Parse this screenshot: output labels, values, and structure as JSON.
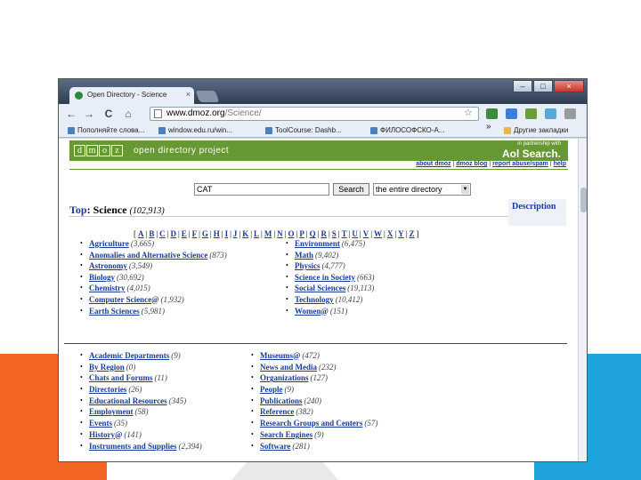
{
  "browser": {
    "tab_title": "Open Directory - Science",
    "tab_close": "×",
    "window_controls": {
      "minimize": "–",
      "maximize": "□",
      "close": "×"
    },
    "nav": {
      "back": "←",
      "forward": "→",
      "reload": "C",
      "home": "⌂"
    },
    "url_host": "www.dmoz.org",
    "url_path": "/Science/",
    "bookmarks": [
      {
        "label": "Пополняйте слова...",
        "icon": "page-icon"
      },
      {
        "label": "window.edu.ru/win...",
        "icon": "page-icon"
      },
      {
        "label": "ToolCourse: Dashb...",
        "icon": "page-icon"
      },
      {
        "label": "ФИЛОСОФСКО-А...",
        "icon": "page-icon"
      },
      {
        "label": "Другие закладки",
        "icon": "folder-icon"
      }
    ],
    "chevron": "»"
  },
  "dmoz": {
    "letters": [
      "d",
      "m",
      "o",
      "z"
    ],
    "tagline": "open directory project",
    "aol_small": "in partnership with",
    "aol": "Aol Search.",
    "toplinks": [
      "about dmoz",
      "dmoz blog",
      "report abuse/spam",
      "help"
    ]
  },
  "search": {
    "query": "CAT",
    "button": "Search",
    "scope": "the entire directory"
  },
  "topline": {
    "top": "Top",
    "colon": ":",
    "category": "Science",
    "count": "(102,913)",
    "description_link": "Description"
  },
  "alphabet": [
    "A",
    "B",
    "C",
    "D",
    "E",
    "F",
    "G",
    "H",
    "I",
    "J",
    "K",
    "L",
    "M",
    "N",
    "O",
    "P",
    "Q",
    "R",
    "S",
    "T",
    "U",
    "V",
    "W",
    "X",
    "Y",
    "Z"
  ],
  "categories_left": [
    {
      "name": "Agriculture",
      "at": "",
      "count": "(3,665)"
    },
    {
      "name": "Anomalies and Alternative Science",
      "at": "",
      "count": "(873)"
    },
    {
      "name": "Astronomy",
      "at": "",
      "count": "(3,549)"
    },
    {
      "name": "Biology",
      "at": "",
      "count": "(30,692)"
    },
    {
      "name": "Chemistry",
      "at": "",
      "count": "(4,015)"
    },
    {
      "name": "Computer Science",
      "at": "@",
      "count": "(1,932)"
    },
    {
      "name": "Earth Sciences",
      "at": "",
      "count": "(5,981)"
    }
  ],
  "categories_right": [
    {
      "name": "Environment",
      "at": "",
      "count": "(6,475)"
    },
    {
      "name": "Math",
      "at": "",
      "count": "(9,402)"
    },
    {
      "name": "Physics",
      "at": "",
      "count": "(4,777)"
    },
    {
      "name": "Science in Society",
      "at": "",
      "count": "(663)"
    },
    {
      "name": "Social Sciences",
      "at": "",
      "count": "(19,113)"
    },
    {
      "name": "Technology",
      "at": "",
      "count": "(10,412)"
    },
    {
      "name": "Women",
      "at": "@",
      "count": "(151)"
    }
  ],
  "related_left": [
    {
      "name": "Academic Departments",
      "at": "",
      "count": "(9)"
    },
    {
      "name": "By Region",
      "at": "",
      "count": "(0)"
    },
    {
      "name": "Chats and Forums",
      "at": "",
      "count": "(11)"
    },
    {
      "name": "Directories",
      "at": "",
      "count": "(26)"
    },
    {
      "name": "Educational Resources",
      "at": "",
      "count": "(345)"
    },
    {
      "name": "Employment",
      "at": "",
      "count": "(58)"
    },
    {
      "name": "Events",
      "at": "",
      "count": "(35)"
    },
    {
      "name": "History",
      "at": "@",
      "count": "(141)"
    },
    {
      "name": "Instruments and Supplies",
      "at": "",
      "count": "(2,394)"
    }
  ],
  "related_right": [
    {
      "name": "Museums",
      "at": "@",
      "count": "(472)"
    },
    {
      "name": "News and Media",
      "at": "",
      "count": "(232)"
    },
    {
      "name": "Organizations",
      "at": "",
      "count": "(127)"
    },
    {
      "name": "People",
      "at": "",
      "count": "(9)"
    },
    {
      "name": "Publications",
      "at": "",
      "count": "(240)"
    },
    {
      "name": "Reference",
      "at": "",
      "count": "(382)"
    },
    {
      "name": "Research Groups and Centers",
      "at": "",
      "count": "(57)"
    },
    {
      "name": "Search Engines",
      "at": "",
      "count": "(9)"
    },
    {
      "name": "Software",
      "at": "",
      "count": "(281)"
    }
  ],
  "bullet": "•",
  "colors": {
    "dmoz_green": "#669933",
    "link_blue": "#1a3c9a",
    "slide_orange": "#f26522",
    "slide_blue": "#1fa3dc"
  }
}
